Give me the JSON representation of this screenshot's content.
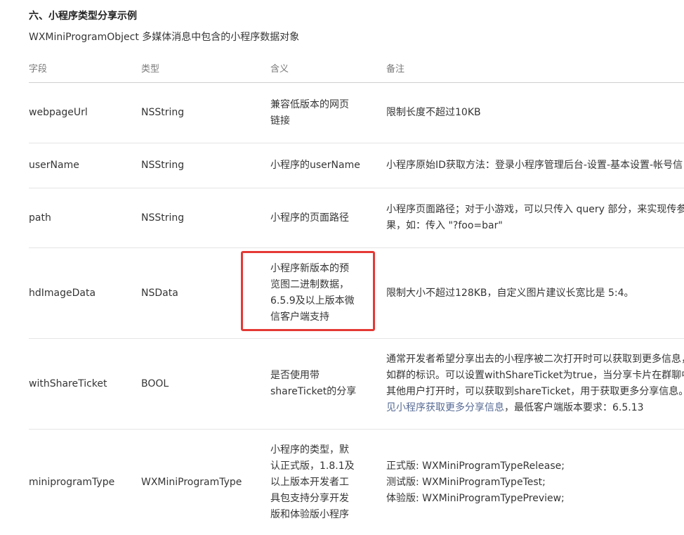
{
  "section_title": "六、小程序类型分享示例",
  "subtitle": "WXMiniProgramObject 多媒体消息中包含的小程序数据对象",
  "columns": [
    "字段",
    "类型",
    "含义",
    "备注"
  ],
  "rows": [
    {
      "field": "webpageUrl",
      "type": "NSString",
      "meaning": [
        "兼容低版本的网页",
        "链接"
      ],
      "note": [
        "限制长度不超过10KB"
      ]
    },
    {
      "field": "userName",
      "type": "NSString",
      "meaning": [
        "小程序的userName"
      ],
      "note": [
        "小程序原始ID获取方法：登录小程序管理后台-设置-基本设置-帐号信"
      ]
    },
    {
      "field": "path",
      "type": "NSString",
      "meaning": [
        "小程序的页面路径"
      ],
      "note": [
        "小程序页面路径；对于小游戏，可以只传入 query 部分，来实现传参",
        "果，如：传入 \"?foo=bar\""
      ]
    },
    {
      "field": "hdImageData",
      "type": "NSData",
      "meaning": [
        "小程序新版本的预",
        "览图二进制数据，",
        "6.5.9及以上版本微",
        "信客户端支持"
      ],
      "note": [
        "限制大小不超过128KB，自定义图片建议长宽比是 5:4。"
      ]
    },
    {
      "field": "withShareTicket",
      "type": "BOOL",
      "meaning": [
        "是否使用带",
        "shareTicket的分享"
      ],
      "note": [
        "通常开发者希望分享出去的小程序被二次打开时可以获取到更多信息，",
        "如群的标识。可以设置withShareTicket为true，当分享卡片在群聊中",
        "其他用户打开时，可以获取到shareTicket，用于获取更多分享信息。"
      ],
      "note_link": "见小程序获取更多分享信息",
      "note_tail": "，最低客户端版本要求：6.5.13"
    },
    {
      "field": "miniprogramType",
      "type": "WXMiniProgramType",
      "meaning": [
        "小程序的类型，默",
        "认正式版，1.8.1及",
        "以上版本开发者工",
        "具包支持分享开发",
        "版和体验版小程序"
      ],
      "note": [
        "正式版: WXMiniProgramTypeRelease;",
        "测试版: WXMiniProgramTypeTest;",
        "体验版: WXMiniProgramTypePreview;"
      ]
    }
  ]
}
